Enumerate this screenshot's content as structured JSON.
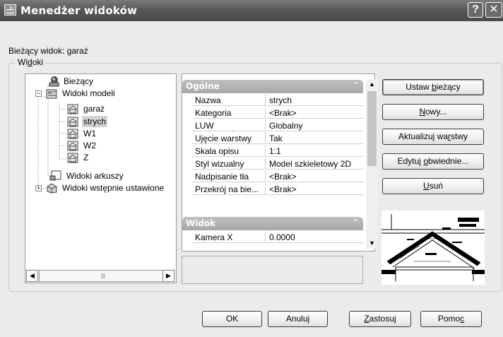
{
  "window": {
    "title": "Menedżer widoków",
    "help_glyph": "?",
    "close_glyph": "✕"
  },
  "current_view": {
    "text": "Bieżący widok: garaż"
  },
  "views_group": {
    "label": "Widoki"
  },
  "tree": {
    "items": [
      {
        "label": "Bieżący",
        "icon": "camera-icon",
        "level": 1,
        "expander": ""
      },
      {
        "label": "Widoki modeli",
        "icon": "model-views-icon",
        "level": 0,
        "expander": "−"
      },
      {
        "label": "garaż",
        "icon": "view-icon",
        "level": 2,
        "expander": ""
      },
      {
        "label": "strych",
        "icon": "view-icon",
        "level": 2,
        "expander": "",
        "selected": true
      },
      {
        "label": "W1",
        "icon": "view-icon",
        "level": 2,
        "expander": ""
      },
      {
        "label": "W2",
        "icon": "view-icon",
        "level": 2,
        "expander": ""
      },
      {
        "label": "Z",
        "icon": "view-icon",
        "level": 2,
        "expander": ""
      },
      {
        "label": "Widoki arkuszy",
        "icon": "layout-views-icon",
        "level": 1,
        "expander": ""
      },
      {
        "label": "Widoki wstępnie ustawione",
        "icon": "preset-views-icon",
        "level": 0,
        "expander": "+"
      }
    ],
    "scroll_left": "◀",
    "scroll_right": "▶",
    "scroll_grip": "|||"
  },
  "properties": {
    "sections": [
      {
        "title": "Ogólne",
        "rows": [
          {
            "key": "Nazwa",
            "value": "strych"
          },
          {
            "key": "Kategoria",
            "value": "<Brak>"
          },
          {
            "key": "LUW",
            "value": "Globalny"
          },
          {
            "key": "Ujęcie warstwy",
            "value": "Tak"
          },
          {
            "key": "Skala opisu",
            "value": "1:1"
          },
          {
            "key": "Styl wizualny",
            "value": "Model szkieletowy 2D"
          },
          {
            "key": "Nadpisanie tła",
            "value": "<Brak>"
          },
          {
            "key": "Przekrój na bie...",
            "value": "<Brak>"
          }
        ]
      },
      {
        "title": "Widok",
        "rows": [
          {
            "key": "Kamera X",
            "value": "0.0000"
          }
        ]
      }
    ],
    "collapse_glyph": "⌃"
  },
  "side_buttons": {
    "set_current": "Ustaw bieżący",
    "new": "Nowy...",
    "update_layers": "Aktualizuj warstwy",
    "edit_boundaries": "Edytuj obwiednie...",
    "delete": "Usuń"
  },
  "bottom_buttons": {
    "ok": "OK",
    "cancel": "Anuluj",
    "apply": "Zastosuj",
    "help": "Pomoc"
  },
  "colors": {
    "titlebar": "#585858",
    "window_bg": "#ebebeb",
    "category_bar": "#b0b0b0",
    "selected_item": "#d4d4d4"
  }
}
